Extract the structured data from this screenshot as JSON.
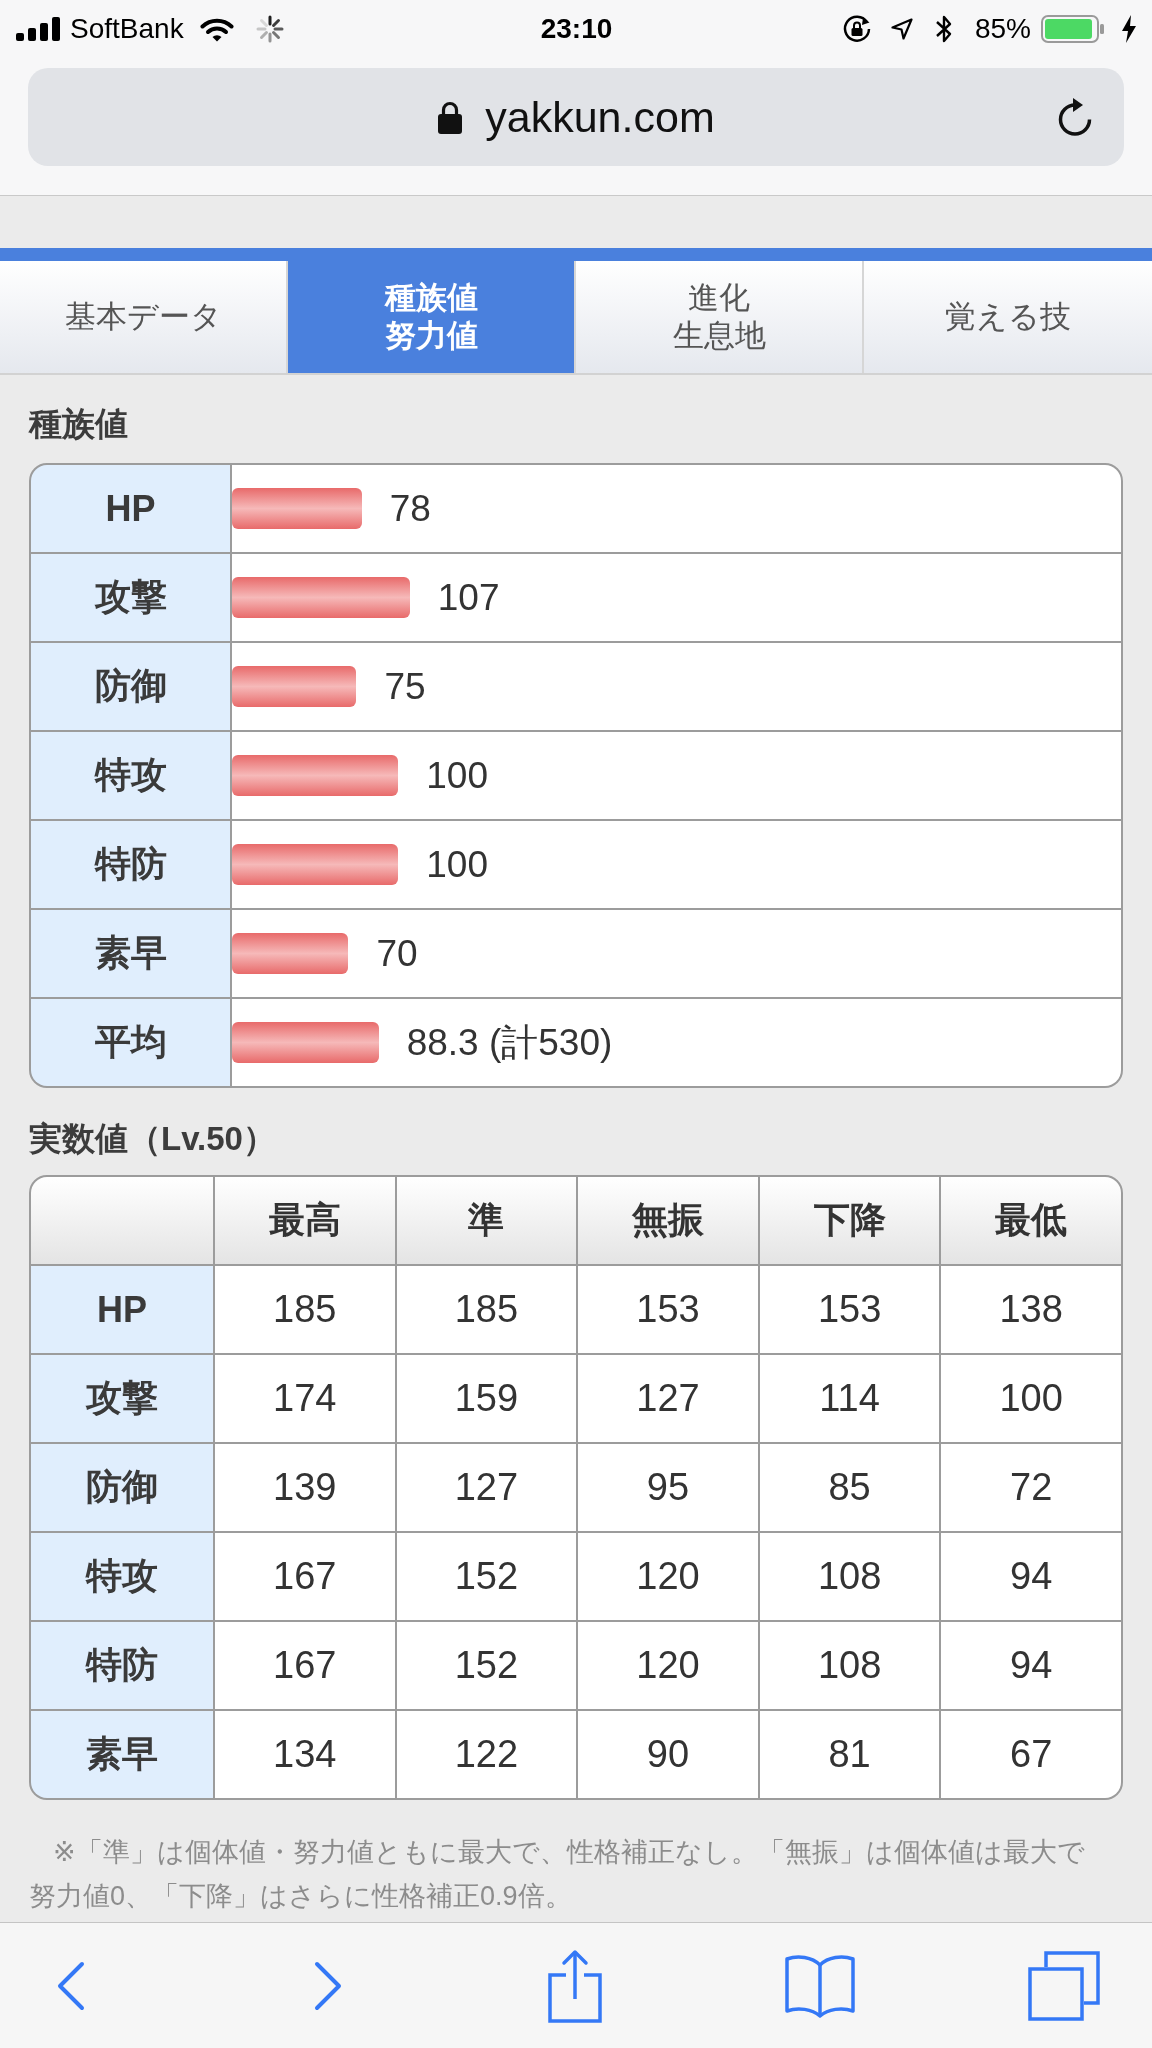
{
  "status_bar": {
    "carrier": "SoftBank",
    "time": "23:10",
    "battery": "85%"
  },
  "address_bar": {
    "url": "yakkun.com"
  },
  "tabs": [
    {
      "lines": [
        "基本データ"
      ],
      "selected": false
    },
    {
      "lines": [
        "種族値",
        "努力値"
      ],
      "selected": true
    },
    {
      "lines": [
        "進化",
        "生息地"
      ],
      "selected": false
    },
    {
      "lines": [
        "覚える技"
      ],
      "selected": false
    }
  ],
  "base_stats": {
    "title": "種族値",
    "rows": [
      {
        "stat": "HP",
        "value": "78",
        "level": 0.146
      },
      {
        "stat": "攻撃",
        "value": "107",
        "level": 0.2
      },
      {
        "stat": "防御",
        "value": "75",
        "level": 0.14
      },
      {
        "stat": "特攻",
        "value": "100",
        "level": 0.187
      },
      {
        "stat": "特防",
        "value": "100",
        "level": 0.187
      },
      {
        "stat": "素早",
        "value": "70",
        "level": 0.131
      },
      {
        "stat": "平均",
        "value": "88.3 (計530)",
        "level": 0.165
      }
    ]
  },
  "actual_stats": {
    "title": "実数値（Lv.50）",
    "columns": [
      "最高",
      "準",
      "無振",
      "下降",
      "最低"
    ],
    "rows": [
      {
        "stat": "HP",
        "values": [
          "185",
          "185",
          "153",
          "153",
          "138"
        ]
      },
      {
        "stat": "攻撃",
        "values": [
          "174",
          "159",
          "127",
          "114",
          "100"
        ]
      },
      {
        "stat": "防御",
        "values": [
          "139",
          "127",
          "95",
          "85",
          "72"
        ]
      },
      {
        "stat": "特攻",
        "values": [
          "167",
          "152",
          "120",
          "108",
          "94"
        ]
      },
      {
        "stat": "特防",
        "values": [
          "167",
          "152",
          "120",
          "108",
          "94"
        ]
      },
      {
        "stat": "素早",
        "values": [
          "134",
          "122",
          "90",
          "81",
          "67"
        ]
      }
    ]
  },
  "note": "※「準」は個体値・努力値ともに最大で、性格補正なし。「無振」は個体値は最大で努力値0、「下降」はさらに性格補正0.9倍。"
}
